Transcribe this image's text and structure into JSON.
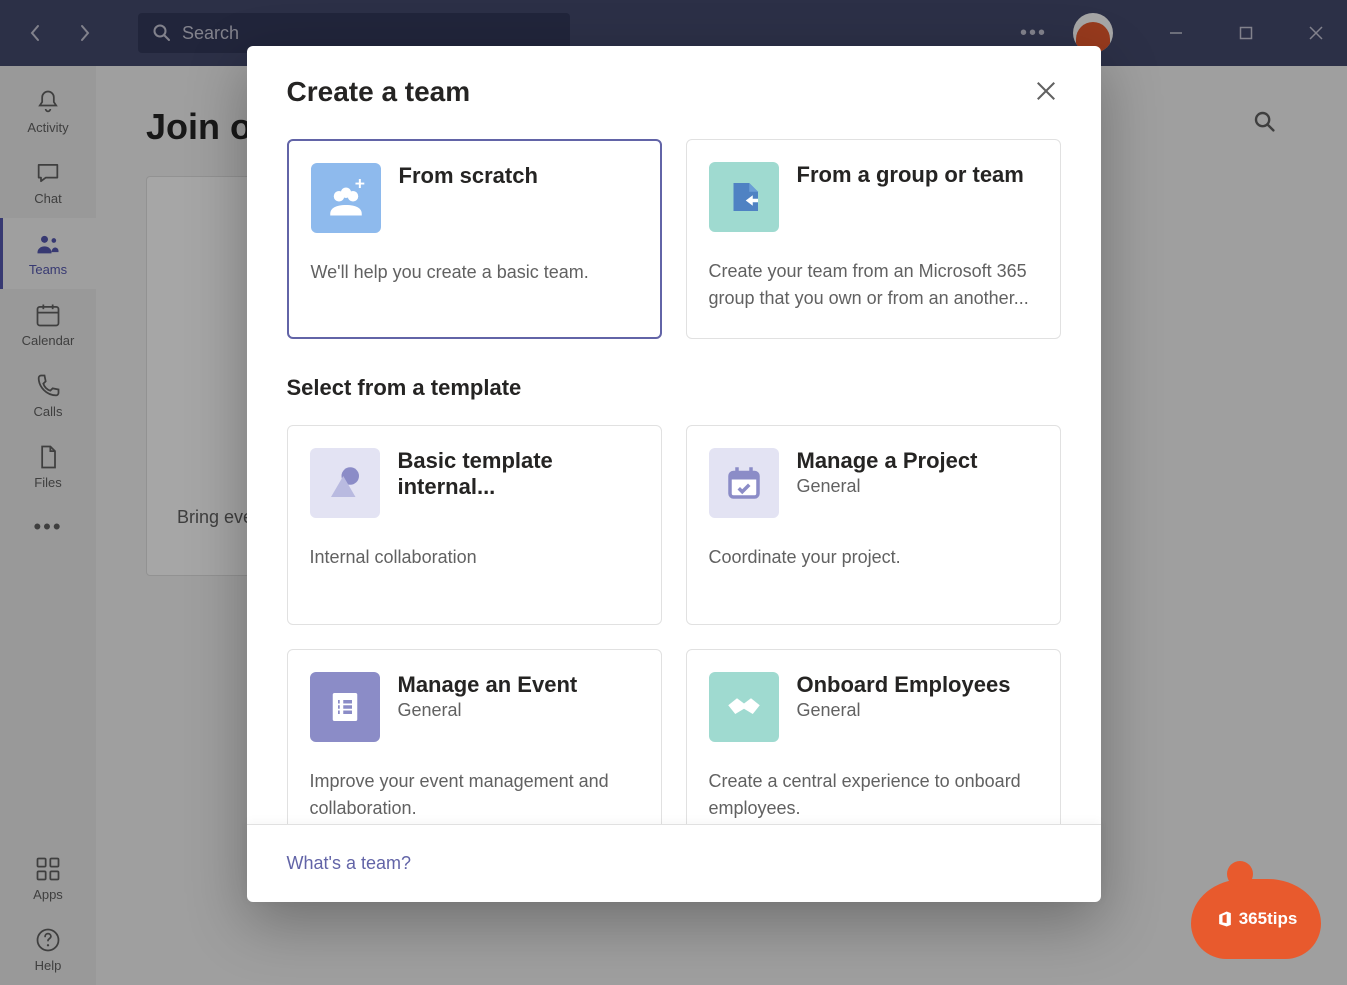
{
  "header": {
    "search_placeholder": "Search"
  },
  "sidebar": {
    "items": [
      {
        "label": "Activity"
      },
      {
        "label": "Chat"
      },
      {
        "label": "Teams"
      },
      {
        "label": "Calendar"
      },
      {
        "label": "Calls"
      },
      {
        "label": "Files"
      }
    ],
    "apps_label": "Apps",
    "help_label": "Help"
  },
  "page": {
    "heading": "Join or create a team",
    "join_card_text": "Bring everyone together and get to work!"
  },
  "modal": {
    "title": "Create a team",
    "options": [
      {
        "title": "From scratch",
        "description": "We'll help you create a basic team."
      },
      {
        "title": "From a group or team",
        "description": "Create your team from an Microsoft 365 group that you own or from an another..."
      }
    ],
    "templates_header": "Select from a template",
    "templates": [
      {
        "title": "Basic template internal...",
        "subtitle": "",
        "description": "Internal collaboration"
      },
      {
        "title": "Manage a Project",
        "subtitle": "General",
        "description": "Coordinate your project."
      },
      {
        "title": "Manage an Event",
        "subtitle": "General",
        "description": "Improve your event management and collaboration."
      },
      {
        "title": "Onboard Employees",
        "subtitle": "General",
        "description": "Create a central experience to onboard employees."
      }
    ],
    "footer_link": "What's a team?"
  },
  "watermark": "365tips"
}
